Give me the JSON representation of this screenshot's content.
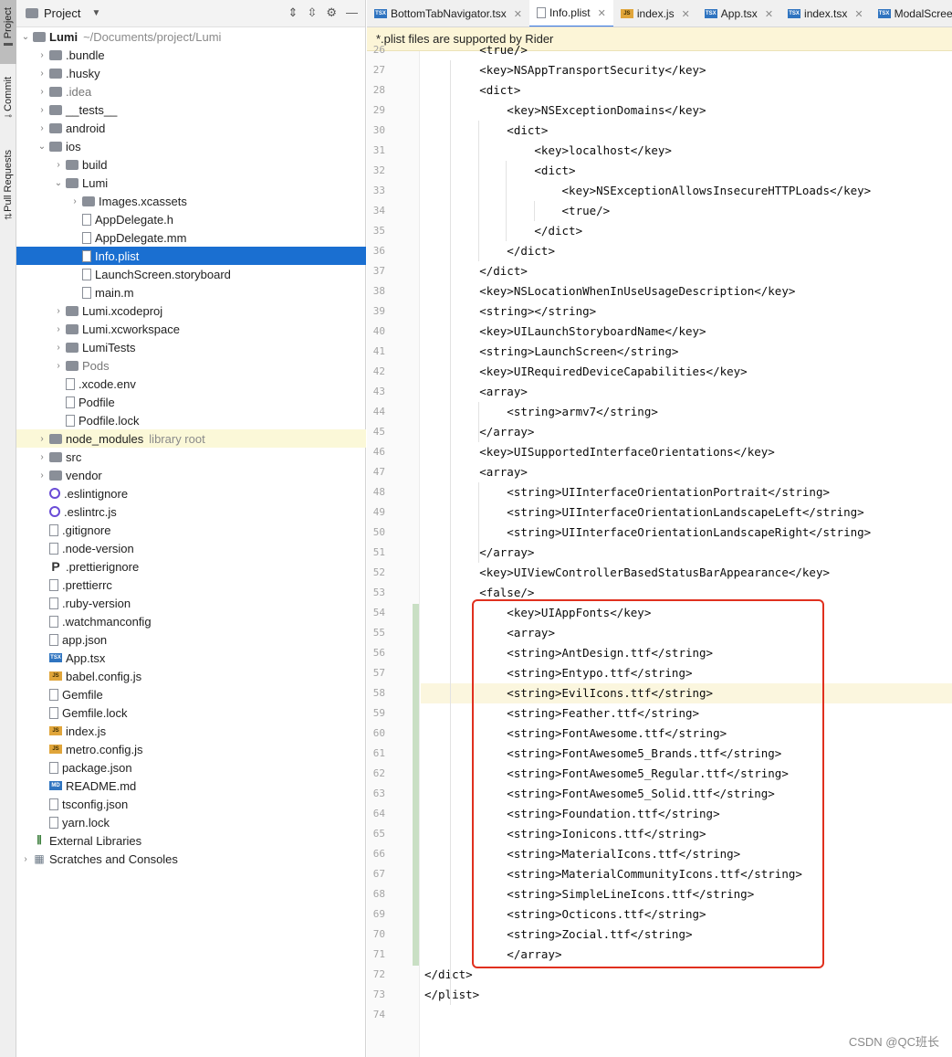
{
  "tool_strip": {
    "project": "Project",
    "commit": "Commit",
    "pull_requests": "Pull Requests"
  },
  "project_panel": {
    "title": "Project",
    "tree": [
      {
        "label": "Lumi",
        "sub": "~/Documents/project/Lumi",
        "arrow": "open",
        "icon": "folder",
        "depth": 0,
        "bold": true
      },
      {
        "label": ".bundle",
        "arrow": "closed",
        "icon": "folder",
        "depth": 1
      },
      {
        "label": ".husky",
        "arrow": "closed",
        "icon": "folder",
        "depth": 1
      },
      {
        "label": ".idea",
        "arrow": "closed",
        "icon": "folder",
        "depth": 1,
        "dim": true
      },
      {
        "label": "__tests__",
        "arrow": "closed",
        "icon": "folder",
        "depth": 1
      },
      {
        "label": "android",
        "arrow": "closed",
        "icon": "folder",
        "depth": 1
      },
      {
        "label": "ios",
        "arrow": "open",
        "icon": "folder",
        "depth": 1
      },
      {
        "label": "build",
        "arrow": "closed",
        "icon": "folder",
        "depth": 2
      },
      {
        "label": "Lumi",
        "arrow": "open",
        "icon": "folder",
        "depth": 2
      },
      {
        "label": "Images.xcassets",
        "arrow": "closed",
        "icon": "folder",
        "depth": 3
      },
      {
        "label": "AppDelegate.h",
        "icon": "file",
        "depth": 3
      },
      {
        "label": "AppDelegate.mm",
        "icon": "file",
        "depth": 3
      },
      {
        "label": "Info.plist",
        "icon": "file",
        "depth": 3,
        "selected": true
      },
      {
        "label": "LaunchScreen.storyboard",
        "icon": "file",
        "depth": 3
      },
      {
        "label": "main.m",
        "icon": "file",
        "depth": 3
      },
      {
        "label": "Lumi.xcodeproj",
        "arrow": "closed",
        "icon": "folder",
        "depth": 2
      },
      {
        "label": "Lumi.xcworkspace",
        "arrow": "closed",
        "icon": "folder",
        "depth": 2
      },
      {
        "label": "LumiTests",
        "arrow": "closed",
        "icon": "folder",
        "depth": 2
      },
      {
        "label": "Pods",
        "arrow": "closed",
        "icon": "folder",
        "depth": 2,
        "dim": true
      },
      {
        "label": ".xcode.env",
        "icon": "file",
        "depth": 2
      },
      {
        "label": "Podfile",
        "icon": "file",
        "depth": 2
      },
      {
        "label": "Podfile.lock",
        "icon": "file",
        "depth": 2
      },
      {
        "label": "node_modules",
        "sub": "library root",
        "arrow": "closed",
        "icon": "folder",
        "depth": 1,
        "lib": true
      },
      {
        "label": "src",
        "arrow": "closed",
        "icon": "folder",
        "depth": 1
      },
      {
        "label": "vendor",
        "arrow": "closed",
        "icon": "folder",
        "depth": 1
      },
      {
        "label": ".eslintignore",
        "icon": "eslint",
        "depth": 1
      },
      {
        "label": ".eslintrc.js",
        "icon": "eslint",
        "depth": 1
      },
      {
        "label": ".gitignore",
        "icon": "file",
        "depth": 1
      },
      {
        "label": ".node-version",
        "icon": "file",
        "depth": 1
      },
      {
        "label": ".prettierignore",
        "icon": "pbold",
        "depth": 1
      },
      {
        "label": ".prettierrc",
        "icon": "file",
        "depth": 1
      },
      {
        "label": ".ruby-version",
        "icon": "file",
        "depth": 1
      },
      {
        "label": ".watchmanconfig",
        "icon": "file",
        "depth": 1
      },
      {
        "label": "app.json",
        "icon": "file",
        "depth": 1
      },
      {
        "label": "App.tsx",
        "icon": "ts",
        "depth": 1
      },
      {
        "label": "babel.config.js",
        "icon": "js",
        "depth": 1
      },
      {
        "label": "Gemfile",
        "icon": "file",
        "depth": 1
      },
      {
        "label": "Gemfile.lock",
        "icon": "file",
        "depth": 1
      },
      {
        "label": "index.js",
        "icon": "js",
        "depth": 1
      },
      {
        "label": "metro.config.js",
        "icon": "js",
        "depth": 1
      },
      {
        "label": "package.json",
        "icon": "file",
        "depth": 1
      },
      {
        "label": "README.md",
        "icon": "md",
        "depth": 1
      },
      {
        "label": "tsconfig.json",
        "icon": "file",
        "depth": 1
      },
      {
        "label": "yarn.lock",
        "icon": "file",
        "depth": 1
      },
      {
        "label": "External Libraries",
        "arrow": "none",
        "icon": "libs",
        "depth": 0
      },
      {
        "label": "Scratches and Consoles",
        "arrow": "closed",
        "icon": "scr",
        "depth": 0
      }
    ]
  },
  "tabs": [
    {
      "label": "BottomTabNavigator.tsx",
      "icon": "ts"
    },
    {
      "label": "Info.plist",
      "icon": "plist",
      "active": true
    },
    {
      "label": "index.js",
      "icon": "js"
    },
    {
      "label": "App.tsx",
      "icon": "ts"
    },
    {
      "label": "index.tsx",
      "icon": "ts"
    },
    {
      "label": "ModalScreen",
      "icon": "ts"
    }
  ],
  "banner": "*.plist files are supported by Rider",
  "first_line_number": 26,
  "code_lines": [
    {
      "n": "26",
      "text": "        <true/>",
      "indent": 2
    },
    {
      "n": "27",
      "text": "        <key>NSAppTransportSecurity</key>",
      "indent": 2
    },
    {
      "n": "28",
      "text": "        <dict>",
      "indent": 2
    },
    {
      "n": "29",
      "text": "            <key>NSExceptionDomains</key>",
      "indent": 3
    },
    {
      "n": "30",
      "text": "            <dict>",
      "indent": 3
    },
    {
      "n": "31",
      "text": "                <key>localhost</key>",
      "indent": 4
    },
    {
      "n": "32",
      "text": "                <dict>",
      "indent": 4
    },
    {
      "n": "33",
      "text": "                    <key>NSExceptionAllowsInsecureHTTPLoads</key>",
      "indent": 5
    },
    {
      "n": "34",
      "text": "                    <true/>",
      "indent": 5
    },
    {
      "n": "35",
      "text": "                </dict>",
      "indent": 4
    },
    {
      "n": "36",
      "text": "            </dict>",
      "indent": 3
    },
    {
      "n": "37",
      "text": "        </dict>",
      "indent": 2
    },
    {
      "n": "38",
      "text": "        <key>NSLocationWhenInUseUsageDescription</key>",
      "indent": 2
    },
    {
      "n": "39",
      "text": "        <string></string>",
      "indent": 2
    },
    {
      "n": "40",
      "text": "        <key>UILaunchStoryboardName</key>",
      "indent": 2
    },
    {
      "n": "41",
      "text": "        <string>LaunchScreen</string>",
      "indent": 2
    },
    {
      "n": "42",
      "text": "        <key>UIRequiredDeviceCapabilities</key>",
      "indent": 2
    },
    {
      "n": "43",
      "text": "        <array>",
      "indent": 2
    },
    {
      "n": "44",
      "text": "            <string>armv7</string>",
      "indent": 3
    },
    {
      "n": "45",
      "text": "        </array>",
      "indent": 2
    },
    {
      "n": "46",
      "text": "        <key>UISupportedInterfaceOrientations</key>",
      "indent": 2
    },
    {
      "n": "47",
      "text": "        <array>",
      "indent": 2
    },
    {
      "n": "48",
      "text": "            <string>UIInterfaceOrientationPortrait</string>",
      "indent": 3
    },
    {
      "n": "49",
      "text": "            <string>UIInterfaceOrientationLandscapeLeft</string>",
      "indent": 3
    },
    {
      "n": "50",
      "text": "            <string>UIInterfaceOrientationLandscapeRight</string>",
      "indent": 3
    },
    {
      "n": "51",
      "text": "        </array>",
      "indent": 2
    },
    {
      "n": "52",
      "text": "        <key>UIViewControllerBasedStatusBarAppearance</key>",
      "indent": 2
    },
    {
      "n": "53",
      "text": "        <false/>",
      "indent": 2
    },
    {
      "n": "54",
      "text": "            <key>UIAppFonts</key>",
      "indent": 3
    },
    {
      "n": "55",
      "text": "            <array>",
      "indent": 3
    },
    {
      "n": "56",
      "text": "            <string>AntDesign.ttf</string>",
      "indent": 3
    },
    {
      "n": "57",
      "text": "            <string>Entypo.ttf</string>",
      "indent": 3
    },
    {
      "n": "58",
      "text": "            <string>EvilIcons.ttf</string>",
      "indent": 3,
      "caret": true
    },
    {
      "n": "59",
      "text": "            <string>Feather.ttf</string>",
      "indent": 3
    },
    {
      "n": "60",
      "text": "            <string>FontAwesome.ttf</string>",
      "indent": 3
    },
    {
      "n": "61",
      "text": "            <string>FontAwesome5_Brands.ttf</string>",
      "indent": 3
    },
    {
      "n": "62",
      "text": "            <string>FontAwesome5_Regular.ttf</string>",
      "indent": 3
    },
    {
      "n": "63",
      "text": "            <string>FontAwesome5_Solid.ttf</string>",
      "indent": 3
    },
    {
      "n": "64",
      "text": "            <string>Foundation.ttf</string>",
      "indent": 3
    },
    {
      "n": "65",
      "text": "            <string>Ionicons.ttf</string>",
      "indent": 3
    },
    {
      "n": "66",
      "text": "            <string>MaterialIcons.ttf</string>",
      "indent": 3
    },
    {
      "n": "67",
      "text": "            <string>MaterialCommunityIcons.ttf</string>",
      "indent": 3
    },
    {
      "n": "68",
      "text": "            <string>SimpleLineIcons.ttf</string>",
      "indent": 3
    },
    {
      "n": "69",
      "text": "            <string>Octicons.ttf</string>",
      "indent": 3
    },
    {
      "n": "70",
      "text": "            <string>Zocial.ttf</string>",
      "indent": 3
    },
    {
      "n": "71",
      "text": "            </array>",
      "indent": 3
    },
    {
      "n": "72",
      "text": "</dict>",
      "indent": 0
    },
    {
      "n": "73",
      "text": "</plist>",
      "indent": 0
    },
    {
      "n": "74",
      "text": "",
      "indent": 0
    }
  ],
  "watermark": "CSDN @QC班长",
  "colors": {
    "selection": "#1a6fd1",
    "highlight_box": "#e0301e",
    "banner_bg": "#fcf5d7",
    "changed_lines": "#c9dfc4"
  }
}
